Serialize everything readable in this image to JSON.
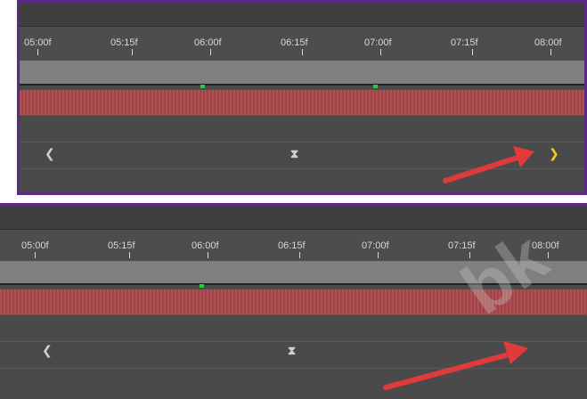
{
  "timeline_ticks": [
    "05:00f",
    "05:15f",
    "06:00f",
    "06:15f",
    "07:00f",
    "07:15f",
    "08:00f"
  ],
  "colors": {
    "panel_border": "#5b2a86",
    "track_red": "#a8474b",
    "keyframe_green": "#1fd12f",
    "active_arrow_yellow": "#f3d11b",
    "callout_arrow_red": "#e03a3a"
  },
  "panel_1": {
    "nav_left_icon": "prev-keyframe-icon",
    "nav_center_icon": "keyframe-hourglass-icon",
    "nav_right_icon": "next-keyframe-icon",
    "nav_right_state": "active"
  },
  "panel_2": {
    "nav_left_icon": "prev-keyframe-icon",
    "nav_center_icon": "keyframe-hourglass-icon",
    "nav_right_state": "hidden"
  }
}
